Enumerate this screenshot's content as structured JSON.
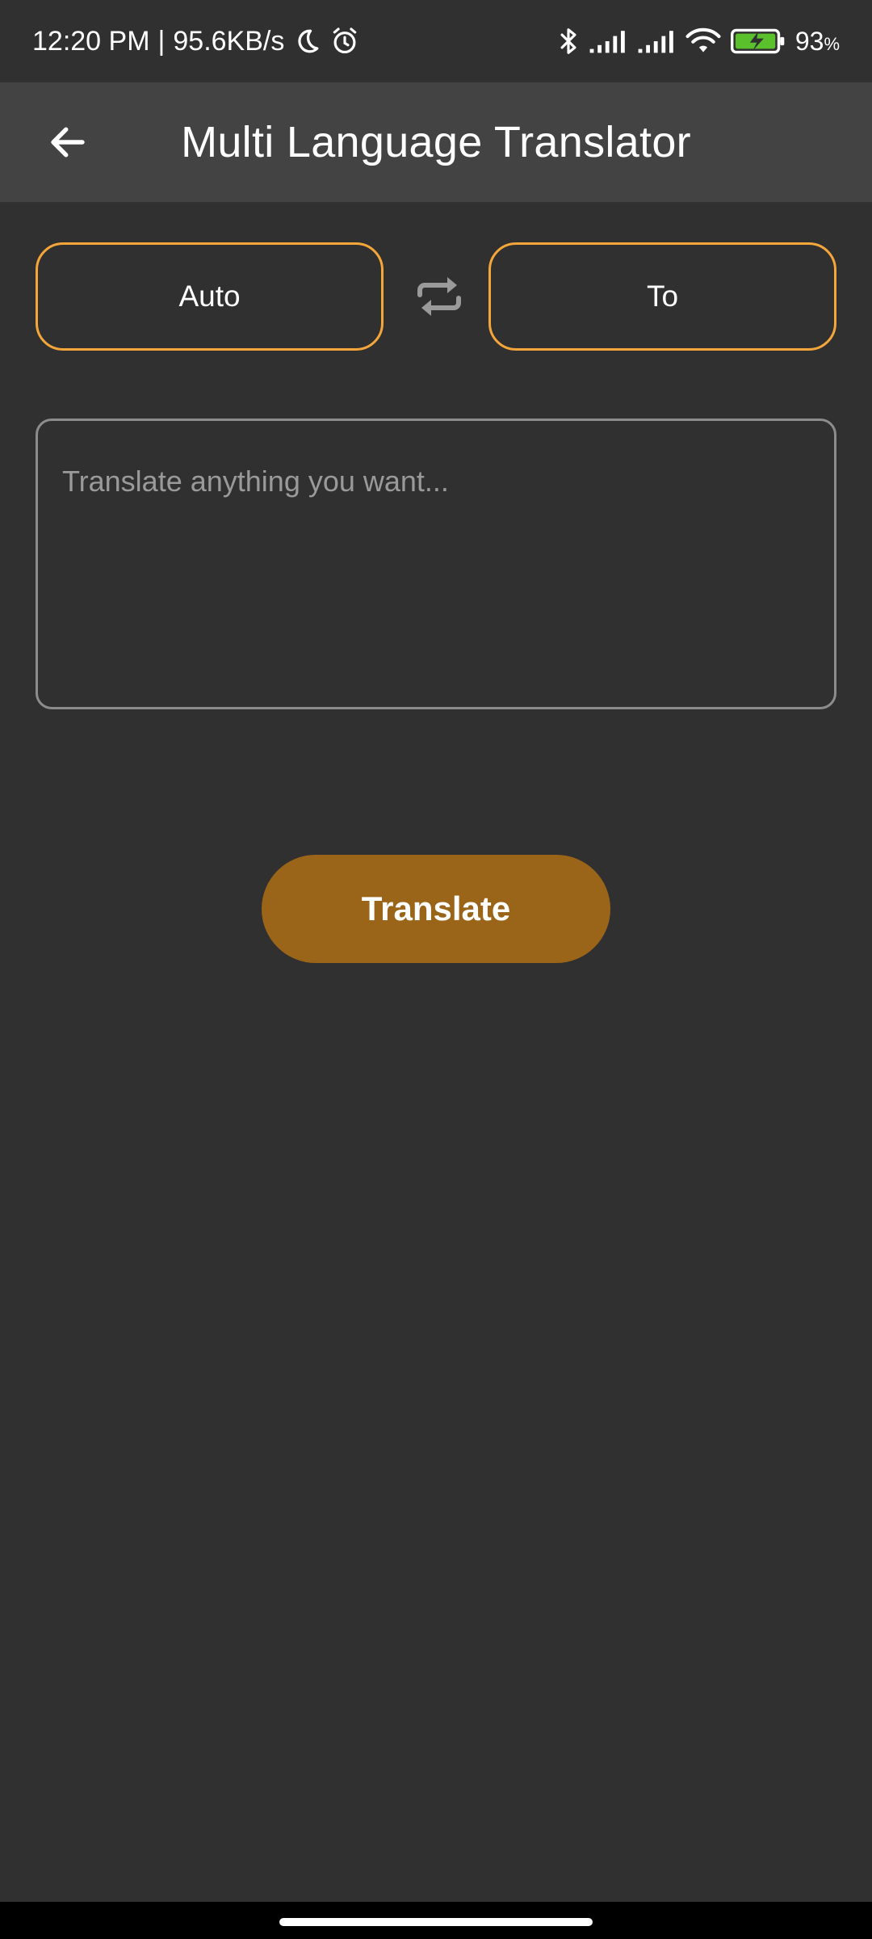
{
  "status_bar": {
    "time": "12:20 PM",
    "separator": "|",
    "network_speed": "95.6KB/s",
    "battery_percent": "93",
    "battery_unit": "%",
    "icons": [
      "moon-icon",
      "alarm-icon",
      "bluetooth-icon",
      "signal-icon",
      "signal-icon",
      "wifi-icon",
      "battery-charging-icon"
    ]
  },
  "app_bar": {
    "title": "Multi Language Translator",
    "back_icon": "arrow-left-icon"
  },
  "languages": {
    "from_label": "Auto",
    "to_label": "To",
    "swap_icon": "swap-arrows-icon"
  },
  "input": {
    "value": "",
    "placeholder": "Translate anything you want..."
  },
  "actions": {
    "translate_label": "Translate"
  },
  "colors": {
    "background": "#303030",
    "app_bar": "#434343",
    "accent_border": "#F5A63A",
    "button": "#9A6518",
    "input_border": "#8c8c8c",
    "battery_fill": "#5ac02c"
  }
}
